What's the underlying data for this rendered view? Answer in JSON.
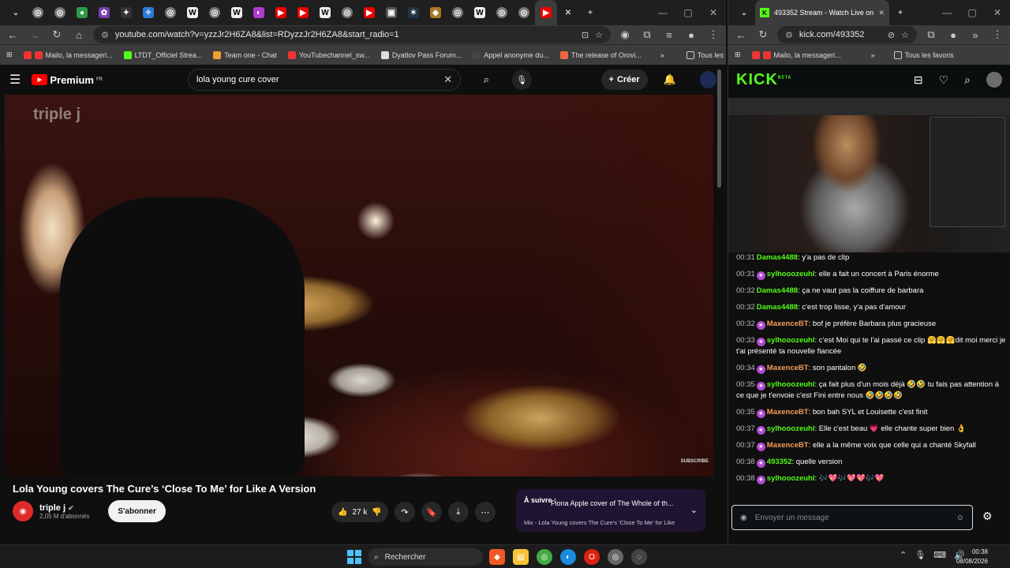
{
  "left_window": {
    "url": "youtube.com/watch?v=yzzJr2H6ZA8&list=RDyzzJr2H6ZA8&start_radio=1",
    "bookmarks": [
      {
        "label": "Mailo, la messageri...",
        "color": "#e33"
      },
      {
        "label": "LTDT_Officiel Strea...",
        "color": "#53fc18"
      },
      {
        "label": "Team one - Chat",
        "color": "#f0a030"
      },
      {
        "label": "YouTubechannel_sw...",
        "color": "#e33"
      },
      {
        "label": "Dyatlov Pass Forum...",
        "color": "#ddd"
      },
      {
        "label": "Appel anonyme du...",
        "color": "#444"
      },
      {
        "label": "The release of Orovi...",
        "color": "#e64"
      }
    ],
    "bookmarks_all": "Tous les favoris",
    "youtube": {
      "logo_text": "Premium",
      "logo_region": "FR",
      "search_value": "lola young cure cover",
      "create_label": "Créer",
      "video": {
        "watermark": "triple j",
        "subscribe_overlay": "SUBSCRIBE",
        "title": "Lola Young covers The Cure’s ‘Close To Me’ for Like A Version"
      },
      "channel": {
        "name": "triple j",
        "subscribers": "2,05 M d'abonnés",
        "subscribe_label": "S'abonner"
      },
      "likes": "27 k",
      "up_next": {
        "label": "À suivre :",
        "title": "Fiona Apple cover of The Whole of th...",
        "mix": "Mix - Lola Young covers The Cure's 'Close To Me' for Like"
      }
    }
  },
  "right_window": {
    "tab_title": "493352 Stream - Watch Live on",
    "url": "kick.com/493352",
    "bookmarks": [
      {
        "label": "Mailo, la messageri...",
        "color": "#e33"
      }
    ],
    "bookmarks_all": "Tous les favoris",
    "kick": {
      "logo": "KICK",
      "logo_badge": "BETA",
      "chat": [
        {
          "time": "00:31",
          "user": "Damas4488",
          "color": "#53fc18",
          "badge": false,
          "text": "y'a pas de clip"
        },
        {
          "time": "00:31",
          "user": "sylhooozeuhl",
          "color": "#53fc18",
          "badge": true,
          "text": "elle a fait un concert à Paris énorme"
        },
        {
          "time": "00:32",
          "user": "Damas4488",
          "color": "#53fc18",
          "badge": false,
          "text": "ça ne vaut pas la coiffure de barbara"
        },
        {
          "time": "00:32",
          "user": "Damas4488",
          "color": "#53fc18",
          "badge": false,
          "text": "c'est trop lisse, y'a pas d'amour"
        },
        {
          "time": "00:32",
          "user": "MaxenceBT",
          "color": "#f39c5a",
          "badge": true,
          "text": "bof je préfère Barbara plus gracieuse"
        },
        {
          "time": "00:33",
          "user": "sylhooozeuhl",
          "color": "#53fc18",
          "badge": true,
          "text": "c'est Moi qui te l'ai passé ce clip 🤗🤗🤗dit moi merci je t'ai présenté ta nouvelle fiancée"
        },
        {
          "time": "00:34",
          "user": "MaxenceBT",
          "color": "#f39c5a",
          "badge": true,
          "text": "son pantalon 🤣"
        },
        {
          "time": "00:35",
          "user": "sylhooozeuhl",
          "color": "#53fc18",
          "badge": true,
          "text": "ça fait plus d'un mois déjà 🤣🤣 tu fais pas attention à ce que je t'envoie c'est Fini entre nous 🤣🤣🤣🤣"
        },
        {
          "time": "00:35",
          "user": "MaxenceBT",
          "color": "#f39c5a",
          "badge": true,
          "text": "bon bah SYL et Louisette c'est finit"
        },
        {
          "time": "00:37",
          "user": "sylhooozeuhl",
          "color": "#53fc18",
          "badge": true,
          "text": "Elle c'est beau 💗 elle chante super bien 👌"
        },
        {
          "time": "00:37",
          "user": "MaxenceBT",
          "color": "#f39c5a",
          "badge": true,
          "text": "elle a la même voix que celle qui a chanté Skyfall"
        },
        {
          "time": "00:38",
          "user": "493352",
          "color": "#53fc18",
          "badge": true,
          "text": "quelle version"
        },
        {
          "time": "00:38",
          "user": "sylhooozeuhl",
          "color": "#53fc18",
          "badge": true,
          "text": "🎶💖🎶💖💖🎶💖"
        }
      ],
      "chat_placeholder": "Envoyer un message"
    }
  },
  "taskbar": {
    "search_label": "Rechercher",
    "time": "00:38",
    "date": "08/08/2026"
  }
}
